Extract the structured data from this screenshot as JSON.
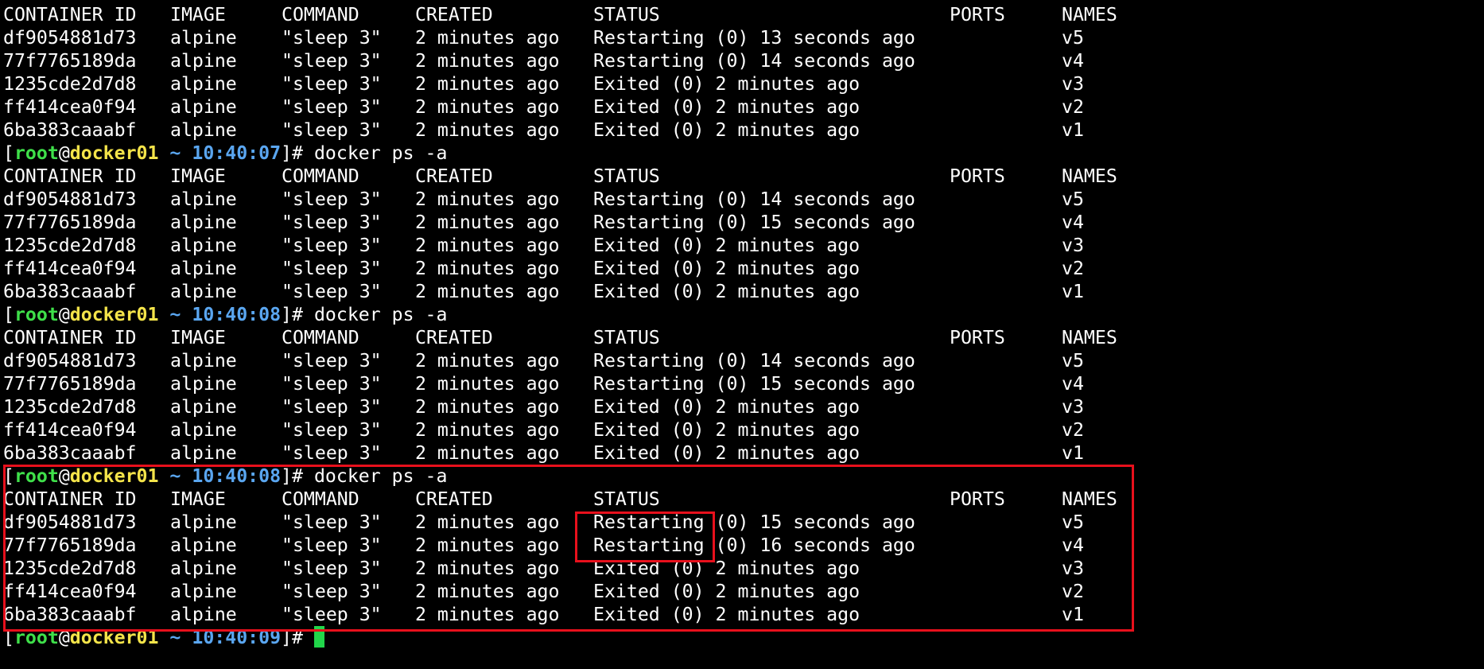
{
  "headers": {
    "id": "CONTAINER ID",
    "image": "IMAGE",
    "command": "COMMAND",
    "created": "CREATED",
    "status": "STATUS",
    "ports": "PORTS",
    "names": "NAMES"
  },
  "prompt_parts": {
    "open": "[",
    "user": "root",
    "at": "@",
    "host": "docker01",
    "tilde": " ~ ",
    "close": "]# ",
    "command": "docker ps -a"
  },
  "blocks": [
    {
      "rows": [
        {
          "id": "df9054881d73",
          "image": "alpine",
          "command": "\"sleep 3\"",
          "created": "2 minutes ago",
          "status": "Restarting (0) 13 seconds ago",
          "ports": "",
          "names": "v5"
        },
        {
          "id": "77f7765189da",
          "image": "alpine",
          "command": "\"sleep 3\"",
          "created": "2 minutes ago",
          "status": "Restarting (0) 14 seconds ago",
          "ports": "",
          "names": "v4"
        },
        {
          "id": "1235cde2d7d8",
          "image": "alpine",
          "command": "\"sleep 3\"",
          "created": "2 minutes ago",
          "status": "Exited (0) 2 minutes ago",
          "ports": "",
          "names": "v3"
        },
        {
          "id": "ff414cea0f94",
          "image": "alpine",
          "command": "\"sleep 3\"",
          "created": "2 minutes ago",
          "status": "Exited (0) 2 minutes ago",
          "ports": "",
          "names": "v2"
        },
        {
          "id": "6ba383caaabf",
          "image": "alpine",
          "command": "\"sleep 3\"",
          "created": "2 minutes ago",
          "status": "Exited (0) 2 minutes ago",
          "ports": "",
          "names": "v1"
        }
      ]
    },
    {
      "prompt_time": "10:40:07",
      "rows": [
        {
          "id": "df9054881d73",
          "image": "alpine",
          "command": "\"sleep 3\"",
          "created": "2 minutes ago",
          "status": "Restarting (0) 14 seconds ago",
          "ports": "",
          "names": "v5"
        },
        {
          "id": "77f7765189da",
          "image": "alpine",
          "command": "\"sleep 3\"",
          "created": "2 minutes ago",
          "status": "Restarting (0) 15 seconds ago",
          "ports": "",
          "names": "v4"
        },
        {
          "id": "1235cde2d7d8",
          "image": "alpine",
          "command": "\"sleep 3\"",
          "created": "2 minutes ago",
          "status": "Exited (0) 2 minutes ago",
          "ports": "",
          "names": "v3"
        },
        {
          "id": "ff414cea0f94",
          "image": "alpine",
          "command": "\"sleep 3\"",
          "created": "2 minutes ago",
          "status": "Exited (0) 2 minutes ago",
          "ports": "",
          "names": "v2"
        },
        {
          "id": "6ba383caaabf",
          "image": "alpine",
          "command": "\"sleep 3\"",
          "created": "2 minutes ago",
          "status": "Exited (0) 2 minutes ago",
          "ports": "",
          "names": "v1"
        }
      ]
    },
    {
      "prompt_time": "10:40:08",
      "rows": [
        {
          "id": "df9054881d73",
          "image": "alpine",
          "command": "\"sleep 3\"",
          "created": "2 minutes ago",
          "status": "Restarting (0) 14 seconds ago",
          "ports": "",
          "names": "v5"
        },
        {
          "id": "77f7765189da",
          "image": "alpine",
          "command": "\"sleep 3\"",
          "created": "2 minutes ago",
          "status": "Restarting (0) 15 seconds ago",
          "ports": "",
          "names": "v4"
        },
        {
          "id": "1235cde2d7d8",
          "image": "alpine",
          "command": "\"sleep 3\"",
          "created": "2 minutes ago",
          "status": "Exited (0) 2 minutes ago",
          "ports": "",
          "names": "v3"
        },
        {
          "id": "ff414cea0f94",
          "image": "alpine",
          "command": "\"sleep 3\"",
          "created": "2 minutes ago",
          "status": "Exited (0) 2 minutes ago",
          "ports": "",
          "names": "v2"
        },
        {
          "id": "6ba383caaabf",
          "image": "alpine",
          "command": "\"sleep 3\"",
          "created": "2 minutes ago",
          "status": "Exited (0) 2 minutes ago",
          "ports": "",
          "names": "v1"
        }
      ]
    },
    {
      "prompt_time": "10:40:08",
      "rows": [
        {
          "id": "df9054881d73",
          "image": "alpine",
          "command": "\"sleep 3\"",
          "created": "2 minutes ago",
          "status": "Restarting (0) 15 seconds ago",
          "ports": "",
          "names": "v5"
        },
        {
          "id": "77f7765189da",
          "image": "alpine",
          "command": "\"sleep 3\"",
          "created": "2 minutes ago",
          "status": "Restarting (0) 16 seconds ago",
          "ports": "",
          "names": "v4"
        },
        {
          "id": "1235cde2d7d8",
          "image": "alpine",
          "command": "\"sleep 3\"",
          "created": "2 minutes ago",
          "status": "Exited (0) 2 minutes ago",
          "ports": "",
          "names": "v3"
        },
        {
          "id": "ff414cea0f94",
          "image": "alpine",
          "command": "\"sleep 3\"",
          "created": "2 minutes ago",
          "status": "Exited (0) 2 minutes ago",
          "ports": "",
          "names": "v2"
        },
        {
          "id": "6ba383caaabf",
          "image": "alpine",
          "command": "\"sleep 3\"",
          "created": "2 minutes ago",
          "status": "Exited (0) 2 minutes ago",
          "ports": "",
          "names": "v1"
        }
      ]
    }
  ],
  "final_prompt_time": "10:40:09",
  "colors": {
    "background": "#000000",
    "text": "#ffffff",
    "user": "#3fe04a",
    "host": "#f4e44a",
    "time": "#5aa6f0",
    "cursor": "#21d64a",
    "highlight": "#e8101c"
  }
}
